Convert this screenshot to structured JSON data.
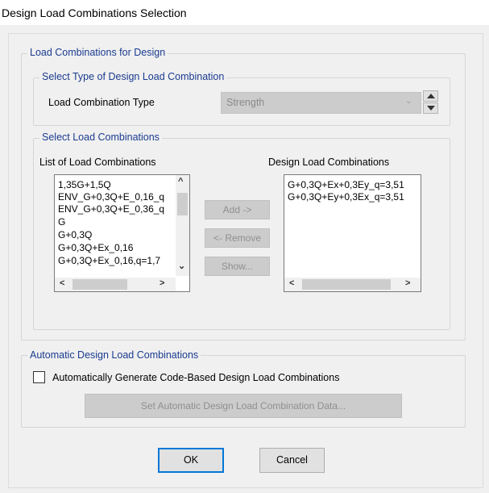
{
  "window": {
    "title": "Design Load Combinations Selection"
  },
  "load_group": {
    "legend": "Load Combinations for Design",
    "type_group": {
      "legend": "Select Type of Design Load Combination",
      "type_label": "Load Combination Type",
      "type_value": "Strength"
    },
    "select_group": {
      "legend": "Select Load Combinations",
      "list_header": "List of Load Combinations",
      "list_items": [
        "1,35G+1,5Q",
        "ENV_G+0,3Q+E_0,16_q",
        "ENV_G+0,3Q+E_0,36_q",
        "G",
        "G+0,3Q",
        "G+0,3Q+Ex_0,16",
        "G+0,3Q+Ex_0,16,q=1,7"
      ],
      "design_header": "Design Load Combinations",
      "design_items": [
        "G+0,3Q+Ex+0,3Ey_q=3,51",
        "G+0,3Q+Ey+0,3Ex_q=3,51"
      ],
      "add_label": "Add ->",
      "remove_label": "<- Remove",
      "show_label": "Show..."
    }
  },
  "auto_group": {
    "legend": "Automatic Design Load Combinations",
    "checkbox_label": "Automatically Generate Code-Based Design Load Combinations",
    "checkbox_checked": false,
    "set_data_label": "Set Automatic Design Load Combination Data..."
  },
  "footer": {
    "ok_label": "OK",
    "cancel_label": "Cancel"
  },
  "colors": {
    "legend_text": "#1a3b8f",
    "disabled_bg": "#cccccc",
    "dialog_bg": "#f0f0f0",
    "focus_border": "#0078d7"
  }
}
